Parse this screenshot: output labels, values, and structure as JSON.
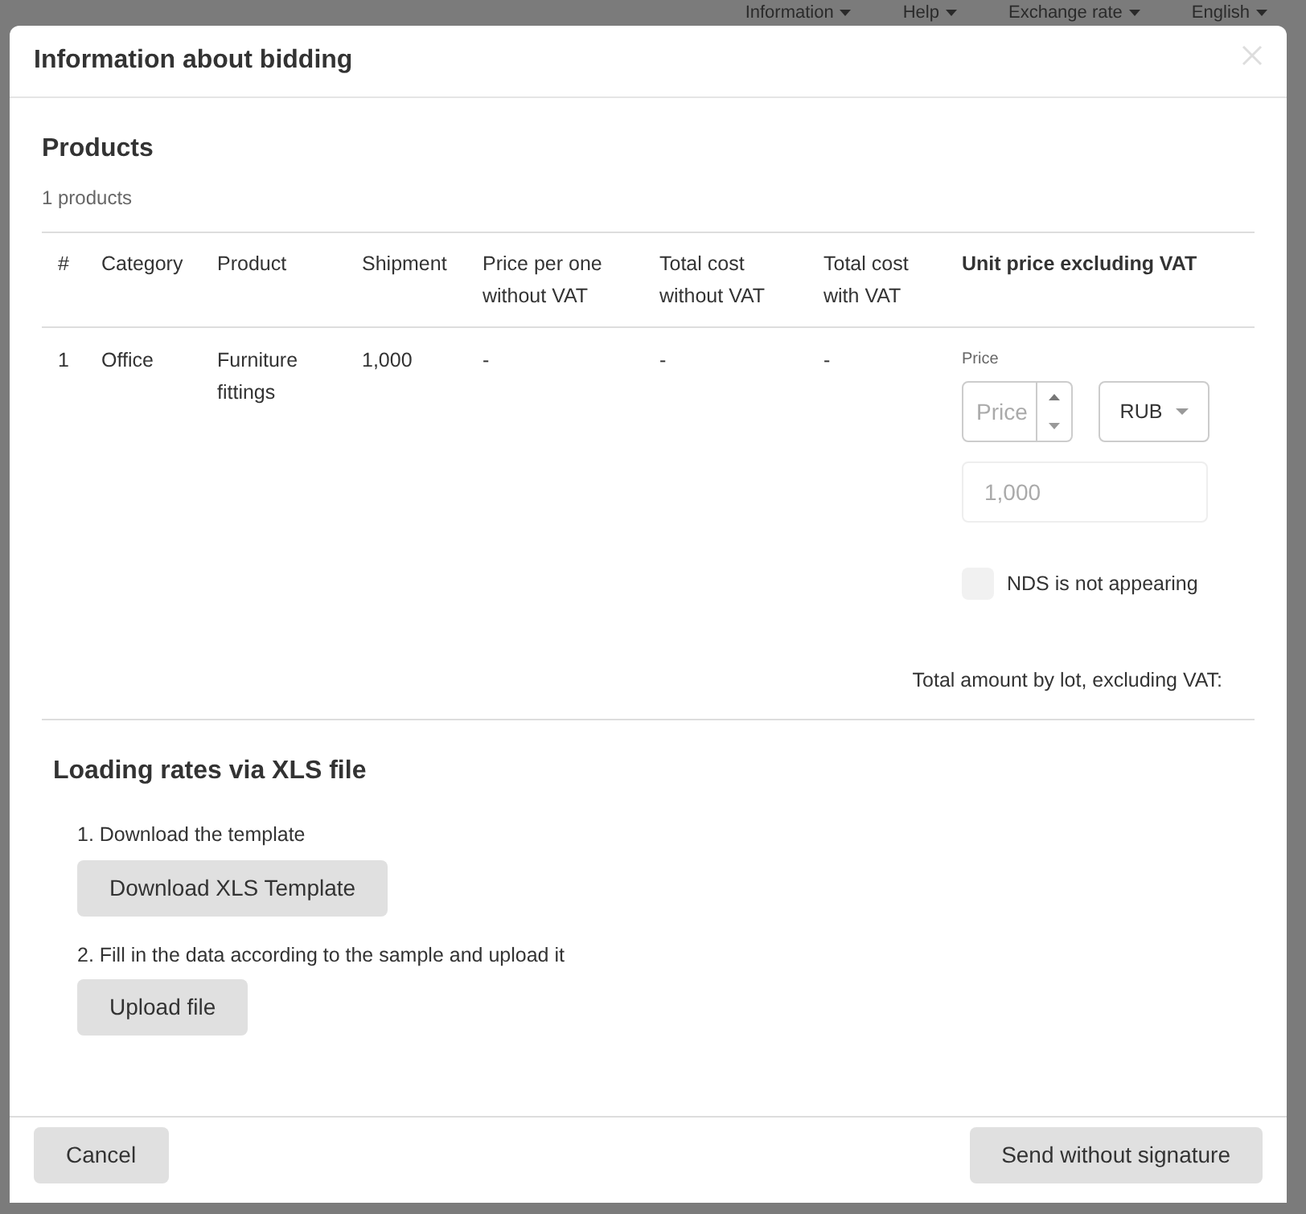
{
  "background": {
    "menu": [
      "Information",
      "Help",
      "Exchange rate",
      "English"
    ]
  },
  "dialog": {
    "title": "Information about bidding",
    "products": {
      "title": "Products",
      "count": "1 products",
      "columns": [
        "#",
        "Category",
        "Product",
        "Shipment",
        "Price per one without VAT",
        "Total cost without VAT",
        "Total cost with VAT",
        "Unit price excluding VAT"
      ],
      "rows": [
        {
          "cells": [
            "1",
            "Office",
            "Furniture fittings",
            "1,000",
            "-",
            "-",
            "-"
          ],
          "price_label": "Price",
          "price_placeholder": "Price",
          "currency": "RUB",
          "amount": "1,000",
          "nds_label": "NDS is not appearing",
          "nds_checked": false
        }
      ],
      "total_label": "Total amount by lot, excluding VAT:"
    },
    "xls": {
      "title": "Loading rates via XLS file",
      "steps": [
        {
          "text": "1. Download the template",
          "button": "Download XLS Template"
        },
        {
          "text": "2. Fill in the data according to the sample and upload it",
          "button": "Upload file"
        }
      ]
    },
    "footer": {
      "cancel": "Cancel",
      "send": "Send without signature"
    }
  }
}
